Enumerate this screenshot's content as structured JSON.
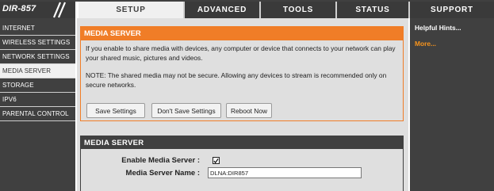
{
  "header": {
    "model": "DIR-857",
    "tabs": [
      {
        "label": "SETUP",
        "active": true
      },
      {
        "label": "ADVANCED",
        "active": false
      },
      {
        "label": "TOOLS",
        "active": false
      },
      {
        "label": "STATUS",
        "active": false
      },
      {
        "label": "SUPPORT",
        "active": false
      }
    ]
  },
  "sidebar": {
    "items": [
      {
        "label": "INTERNET",
        "active": false
      },
      {
        "label": "WIRELESS SETTINGS",
        "active": false
      },
      {
        "label": "NETWORK SETTINGS",
        "active": false
      },
      {
        "label": "MEDIA SERVER",
        "active": true
      },
      {
        "label": "STORAGE",
        "active": false
      },
      {
        "label": "IPV6",
        "active": false
      },
      {
        "label": "PARENTAL CONTROL",
        "active": false
      }
    ]
  },
  "intro": {
    "title": "MEDIA SERVER",
    "description": "If you enable to share media with devices, any computer or device that connects to your network can play your shared music, pictures and videos.",
    "note": "NOTE: The shared media may not be secure. Allowing any devices to stream is recommended only on secure networks.",
    "buttons": {
      "save": "Save Settings",
      "dont_save": "Don't Save Settings",
      "reboot": "Reboot Now"
    }
  },
  "media_server": {
    "title": "MEDIA SERVER",
    "enable_label": "Enable Media Server :",
    "enabled": true,
    "name_label": "Media Server Name :",
    "name_value": "DLNA:DIR857"
  },
  "support": {
    "title": "Helpful Hints...",
    "more": "More..."
  },
  "colors": {
    "accent_orange": "#f07d27",
    "dark_gray": "#404040",
    "panel_bg": "#dfdfdf",
    "link_orange": "#f7941d"
  }
}
